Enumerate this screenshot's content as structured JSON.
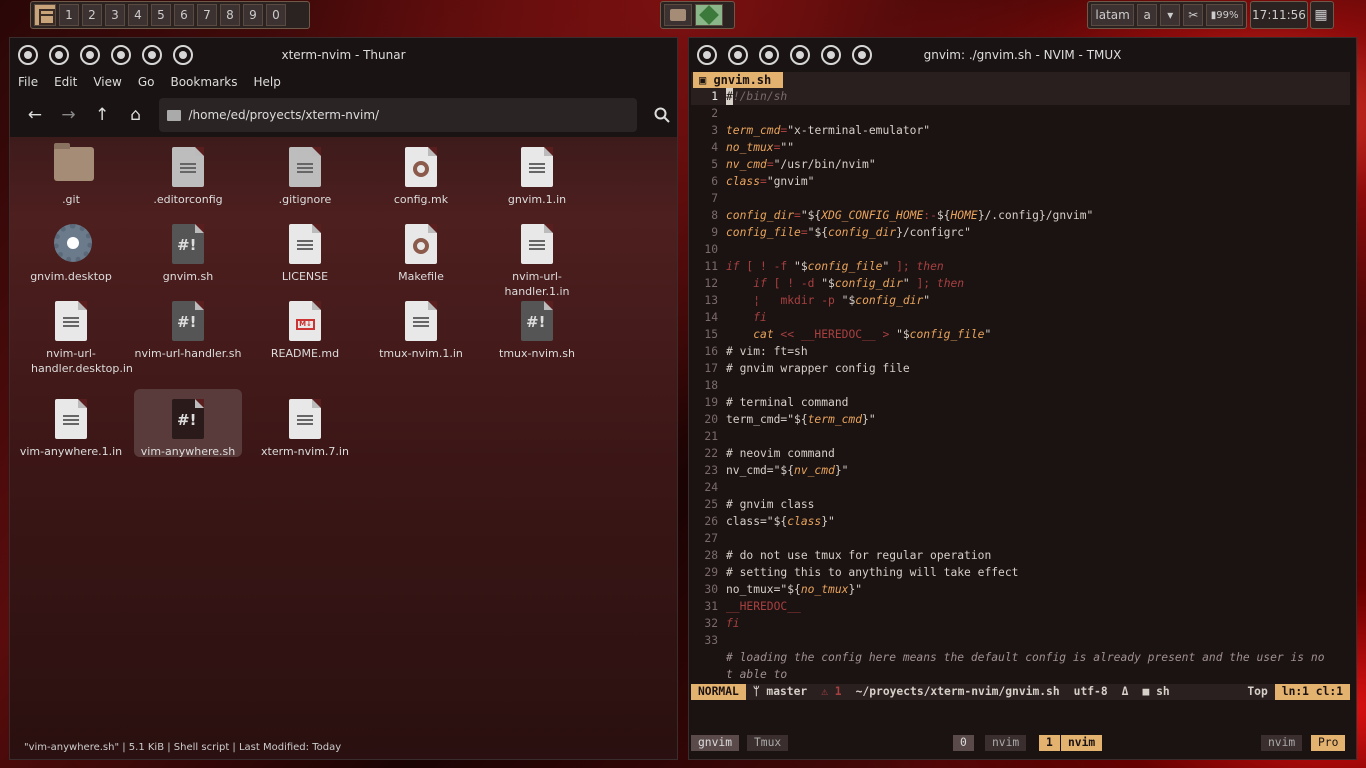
{
  "topbar": {
    "workspaces": [
      "1",
      "2",
      "3",
      "4",
      "5",
      "6",
      "7",
      "8",
      "9",
      "0"
    ],
    "layout": "latam",
    "keyboard_mode": "a",
    "battery": "99%",
    "clock": "17:11:56"
  },
  "thunar": {
    "title": "xterm-nvim - Thunar",
    "menu": [
      "File",
      "Edit",
      "View",
      "Go",
      "Bookmarks",
      "Help"
    ],
    "path": "/home/ed/proyects/xterm-nvim/",
    "files": [
      {
        "name": ".git",
        "type": "folder"
      },
      {
        "name": ".editorconfig",
        "type": "text-grey"
      },
      {
        "name": ".gitignore",
        "type": "text-grey"
      },
      {
        "name": "config.mk",
        "type": "gear"
      },
      {
        "name": "gnvim.1.in",
        "type": "text"
      },
      {
        "name": "gnvim.desktop",
        "type": "desktop"
      },
      {
        "name": "gnvim.sh",
        "type": "script"
      },
      {
        "name": "LICENSE",
        "type": "text"
      },
      {
        "name": "Makefile",
        "type": "gear"
      },
      {
        "name": "nvim-url-handler.1.in",
        "type": "text"
      },
      {
        "name": "nvim-url-handler.desktop.in",
        "type": "text"
      },
      {
        "name": "nvim-url-handler.sh",
        "type": "script"
      },
      {
        "name": "README.md",
        "type": "markdown"
      },
      {
        "name": "tmux-nvim.1.in",
        "type": "text"
      },
      {
        "name": "tmux-nvim.sh",
        "type": "script"
      },
      {
        "name": "vim-anywhere.1.in",
        "type": "text"
      },
      {
        "name": "vim-anywhere.sh",
        "type": "script-selected"
      },
      {
        "name": "xterm-nvim.7.in",
        "type": "text"
      }
    ],
    "status": "\"vim-anywhere.sh\" | 5.1 KiB | Shell script | Last Modified: Today"
  },
  "nvim": {
    "title": "gnvim: ./gnvim.sh - NVIM - TMUX",
    "tab": "gnvim.sh",
    "lines": [
      [
        [
          "cur",
          "#"
        ],
        [
          "cmt",
          "!/bin/sh"
        ]
      ],
      [],
      [
        [
          "var",
          "term_cmd"
        ],
        [
          "op",
          "="
        ],
        [
          "str",
          "\"x-terminal-emulator\""
        ]
      ],
      [
        [
          "var",
          "no_tmux"
        ],
        [
          "op",
          "="
        ],
        [
          "str",
          "\"\""
        ]
      ],
      [
        [
          "var",
          "nv_cmd"
        ],
        [
          "op",
          "="
        ],
        [
          "str",
          "\"/usr/bin/nvim\""
        ]
      ],
      [
        [
          "var",
          "class"
        ],
        [
          "op",
          "="
        ],
        [
          "str",
          "\"gnvim\""
        ]
      ],
      [],
      [
        [
          "var",
          "config_dir"
        ],
        [
          "op",
          "="
        ],
        [
          "str",
          "\"${"
        ],
        [
          "var",
          "XDG_CONFIG_HOME"
        ],
        [
          "op",
          ":-"
        ],
        [
          "str",
          "${"
        ],
        [
          "var",
          "HOME"
        ],
        [
          "str",
          "}/.config}/gnvim\""
        ]
      ],
      [
        [
          "var",
          "config_file"
        ],
        [
          "op",
          "="
        ],
        [
          "str",
          "\"${"
        ],
        [
          "var",
          "config_dir"
        ],
        [
          "str",
          "}/configrc\""
        ]
      ],
      [],
      [
        [
          "kw",
          "if"
        ],
        [
          "op",
          " [ ! -f "
        ],
        [
          "str",
          "\"$"
        ],
        [
          "var",
          "config_file"
        ],
        [
          "str",
          "\""
        ],
        [
          "op",
          " ]; "
        ],
        [
          "kw",
          "then"
        ]
      ],
      [
        [
          "plain",
          "    "
        ],
        [
          "kw",
          "if"
        ],
        [
          "op",
          " [ ! -d "
        ],
        [
          "str",
          "\"$"
        ],
        [
          "var",
          "config_dir"
        ],
        [
          "str",
          "\""
        ],
        [
          "op",
          " ]; "
        ],
        [
          "kw",
          "then"
        ]
      ],
      [
        [
          "plain",
          "    "
        ],
        [
          "op",
          "¦   "
        ],
        [
          "op",
          "mkdir -p "
        ],
        [
          "str",
          "\"$"
        ],
        [
          "var",
          "config_dir"
        ],
        [
          "str",
          "\""
        ]
      ],
      [
        [
          "plain",
          "    "
        ],
        [
          "kw",
          "fi"
        ]
      ],
      [
        [
          "plain",
          "    "
        ],
        [
          "var",
          "cat"
        ],
        [
          "op",
          " << __HEREDOC__ > "
        ],
        [
          "str",
          "\"$"
        ],
        [
          "var",
          "config_file"
        ],
        [
          "str",
          "\""
        ]
      ],
      [
        [
          "plain",
          "# vim: ft=sh"
        ]
      ],
      [
        [
          "plain",
          "# gnvim wrapper config file"
        ]
      ],
      [],
      [
        [
          "plain",
          "# terminal command"
        ]
      ],
      [
        [
          "plain",
          "term_cmd=\"${"
        ],
        [
          "var",
          "term_cmd"
        ],
        [
          "plain",
          "}\""
        ]
      ],
      [],
      [
        [
          "plain",
          "# neovim command"
        ]
      ],
      [
        [
          "plain",
          "nv_cmd=\"${"
        ],
        [
          "var",
          "nv_cmd"
        ],
        [
          "plain",
          "}\""
        ]
      ],
      [],
      [
        [
          "plain",
          "# gnvim class"
        ]
      ],
      [
        [
          "plain",
          "class=\"${"
        ],
        [
          "var",
          "class"
        ],
        [
          "plain",
          "}\""
        ]
      ],
      [],
      [
        [
          "plain",
          "# do not use tmux for regular operation"
        ]
      ],
      [
        [
          "plain",
          "# setting this to anything will take effect"
        ]
      ],
      [
        [
          "plain",
          "no_tmux=\"${"
        ],
        [
          "var",
          "no_tmux"
        ],
        [
          "plain",
          "}\""
        ]
      ],
      [
        [
          "op",
          "__HEREDOC__"
        ]
      ],
      [
        [
          "kw",
          "fi"
        ]
      ],
      [],
      [
        [
          "cmti",
          "# loading the config here means the default config is already present and the user is no"
        ]
      ],
      [
        [
          "cmti",
          "t able to"
        ]
      ]
    ],
    "statusline": {
      "mode": "NORMAL",
      "branch": "ᛘ master",
      "warn": "⚠ 1",
      "file": "~/proyects/xterm-nvim/gnvim.sh",
      "enc": "utf-8",
      "ff": "Δ",
      "ft": "■ sh",
      "pos": "Top",
      "lncol": "ln:1 cl:1"
    },
    "tmux": {
      "session": "gnvim",
      "label": "Tmux",
      "win0_idx": "0",
      "win0": "nvim",
      "win1_idx": "1",
      "win1": "nvim",
      "right1": "nvim",
      "right2": "Pro"
    }
  },
  "colors": {
    "accent": "#e3b26f",
    "bg": "#1b1212",
    "keyword": "#a84040"
  }
}
